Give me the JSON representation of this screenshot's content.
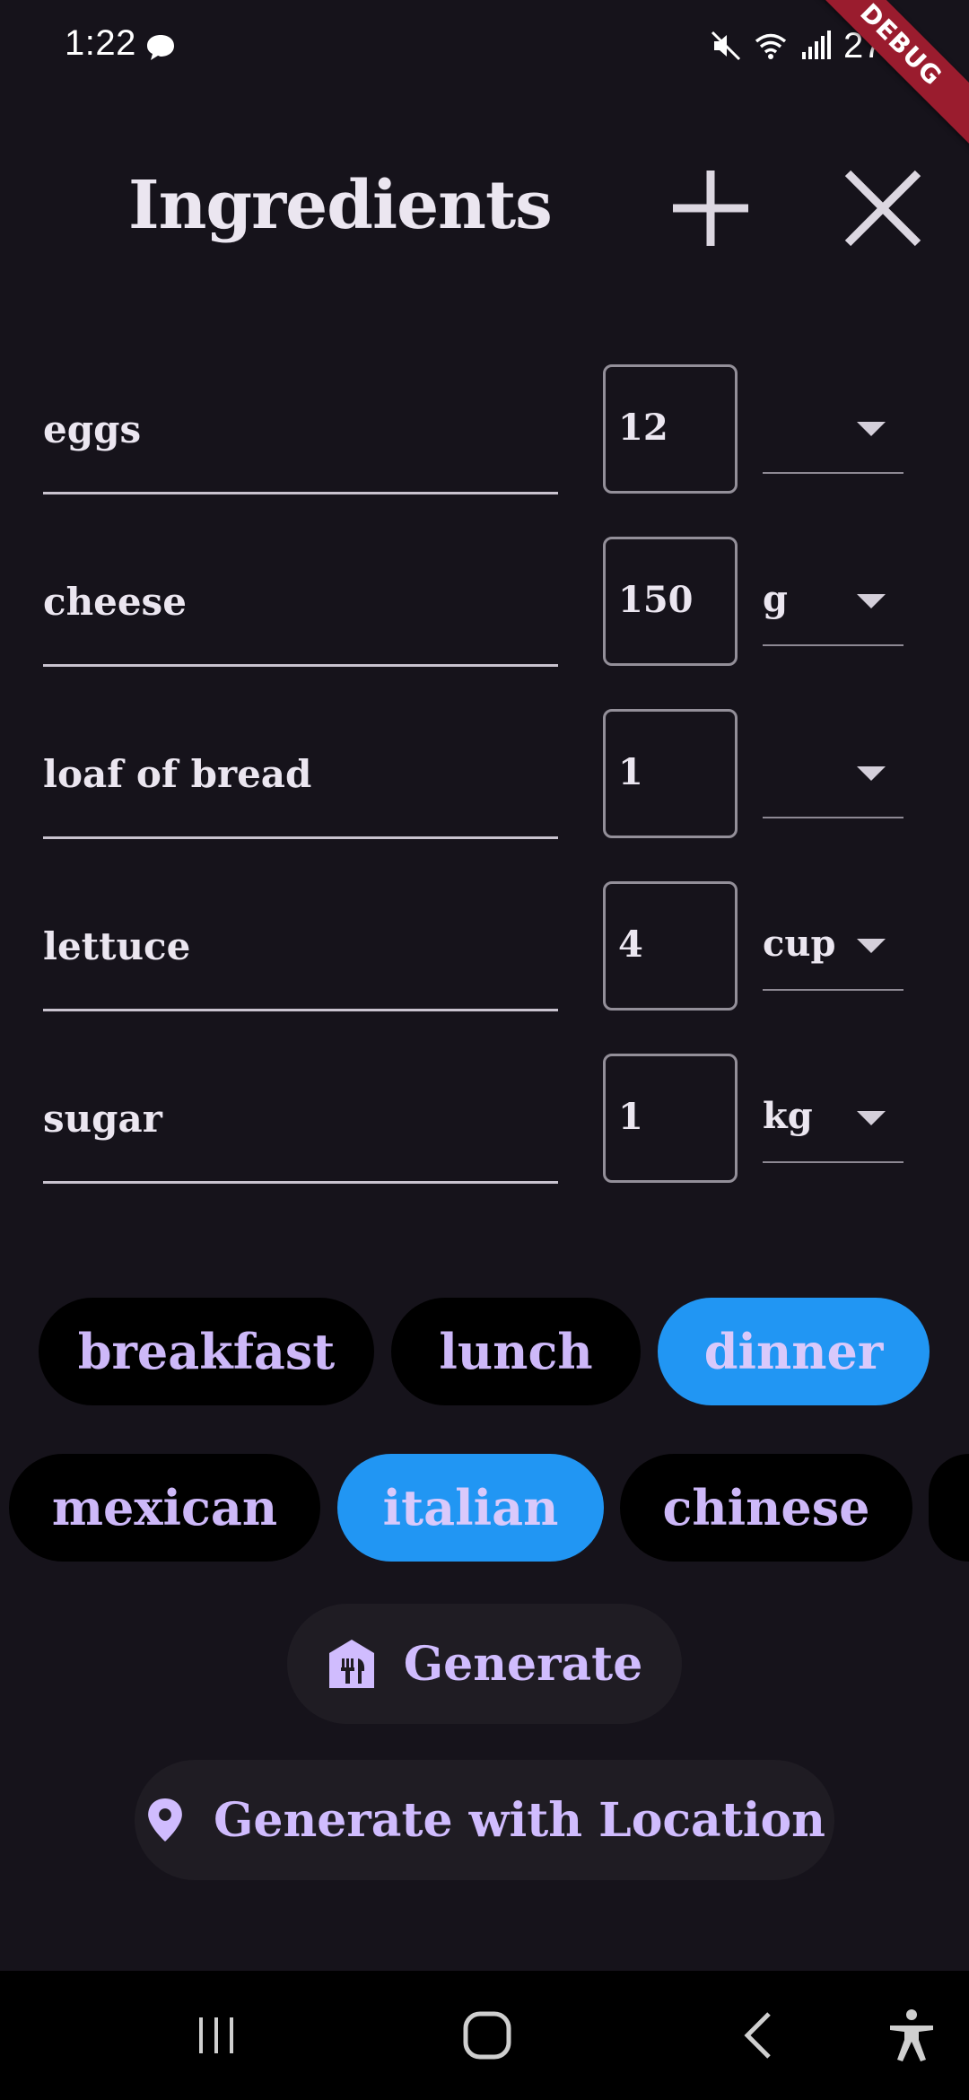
{
  "status_bar": {
    "time": "1:22",
    "battery": "27%",
    "debug_label": "DEBUG",
    "chat_icon": "chat-bubble-icon",
    "mute_icon": "mute-icon",
    "wifi_icon": "wifi-icon",
    "signal_icon": "signal-icon"
  },
  "header": {
    "title": "Ingredients",
    "add_icon": "plus-icon",
    "close_icon": "close-icon"
  },
  "ingredients": [
    {
      "name": "eggs",
      "quantity": "12",
      "unit": ""
    },
    {
      "name": "cheese",
      "quantity": "150",
      "unit": "g"
    },
    {
      "name": "loaf of bread",
      "quantity": "1",
      "unit": ""
    },
    {
      "name": "lettuce",
      "quantity": "4",
      "unit": "cup"
    },
    {
      "name": "sugar",
      "quantity": "1",
      "unit": "kg"
    }
  ],
  "meal_types": [
    {
      "label": "breakfast",
      "selected": false
    },
    {
      "label": "lunch",
      "selected": false
    },
    {
      "label": "dinner",
      "selected": true
    }
  ],
  "cuisines": [
    {
      "label": "mexican",
      "selected": false
    },
    {
      "label": "italian",
      "selected": true
    },
    {
      "label": "chinese",
      "selected": false
    }
  ],
  "actions": {
    "generate_label": "Generate",
    "generate_icon": "restaurant-icon",
    "generate_location_label": "Generate with Location",
    "generate_location_icon": "location-pin-icon"
  },
  "colors": {
    "background": "#16131b",
    "chip_selected": "#2196f3",
    "chip_unselected": "#000000",
    "chip_text": "#cdb8f8",
    "button_bg": "#1f1c23",
    "accent_text": "#d0bcfe"
  },
  "nav": {
    "recents_icon": "recents-icon",
    "home_icon": "home-icon",
    "back_icon": "back-icon",
    "accessibility_icon": "accessibility-icon"
  }
}
